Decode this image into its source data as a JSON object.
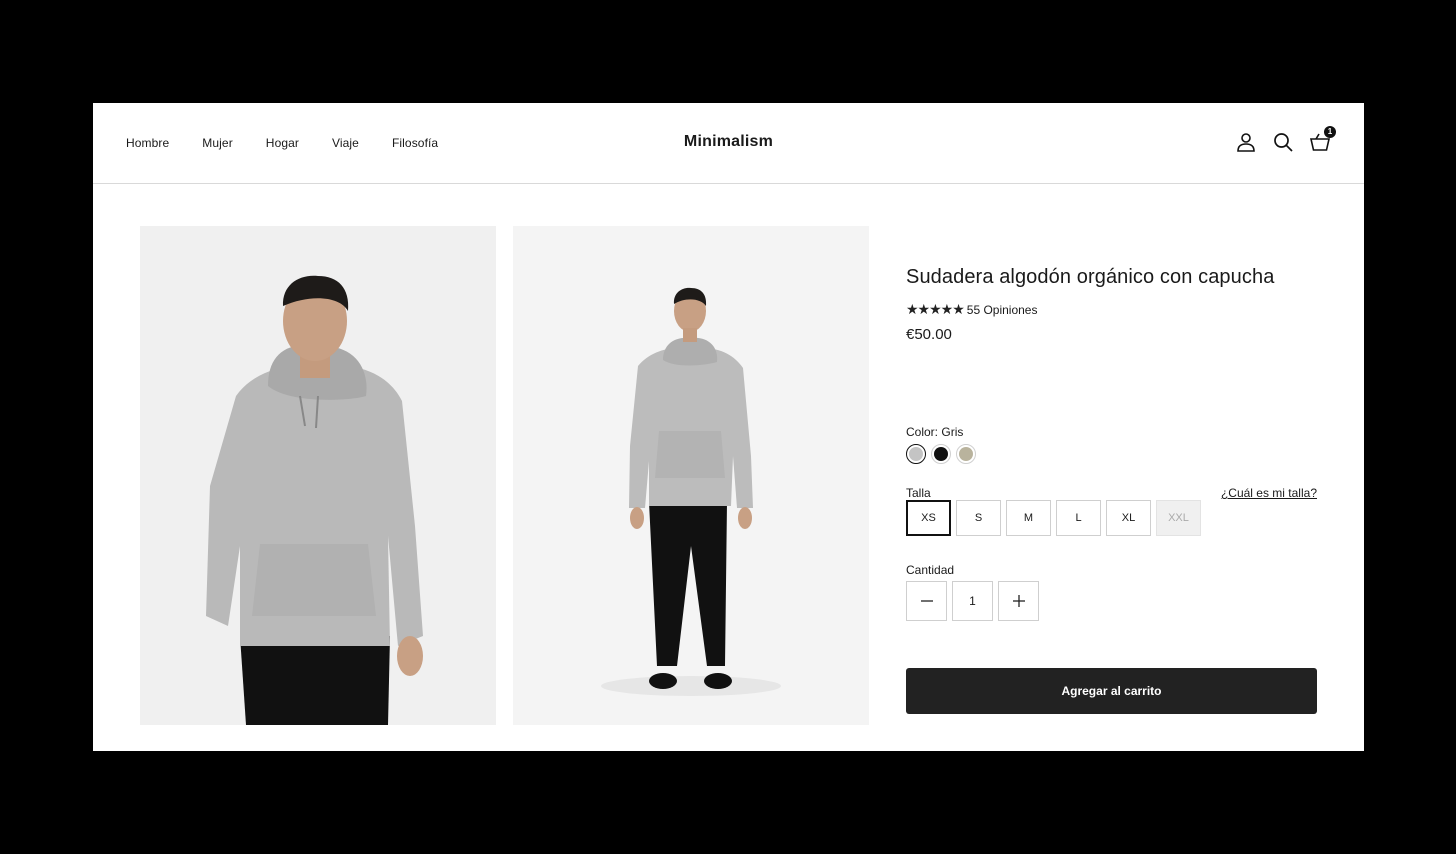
{
  "header": {
    "nav": [
      "Hombre",
      "Mujer",
      "Hogar",
      "Viaje",
      "Filosofía"
    ],
    "brand": "Minimalism",
    "cart_count": "1",
    "icons": [
      "account-icon",
      "search-icon",
      "cart-icon"
    ]
  },
  "gallery": {
    "images": [
      "model-front-closeup",
      "model-full-body"
    ]
  },
  "product": {
    "title": "Sudadera algodón orgánico con capucha",
    "stars": "★★★★★",
    "reviews": "55 Opiniones",
    "price": "€50.00",
    "color_label": "Color:",
    "color_value": "Gris",
    "colors": [
      {
        "name": "Gris",
        "hex": "#c4c4c4",
        "selected": true
      },
      {
        "name": "Negro",
        "hex": "#111111",
        "selected": false
      },
      {
        "name": "Beige",
        "hex": "#b9b39d",
        "selected": false
      }
    ],
    "size_label": "Talla",
    "size_guide": "¿Cuál es mi talla?",
    "sizes": [
      "XS",
      "S",
      "M",
      "L",
      "XL",
      "XXL"
    ],
    "selected_size": "XS",
    "unavailable_size": "XXL",
    "quantity_label": "Cantidad",
    "quantity": "1",
    "add_to_cart": "Agregar al carrito"
  },
  "colors": {
    "button_bg": "#222222",
    "page_bg": "#ffffff",
    "frame_bg": "#000000"
  }
}
